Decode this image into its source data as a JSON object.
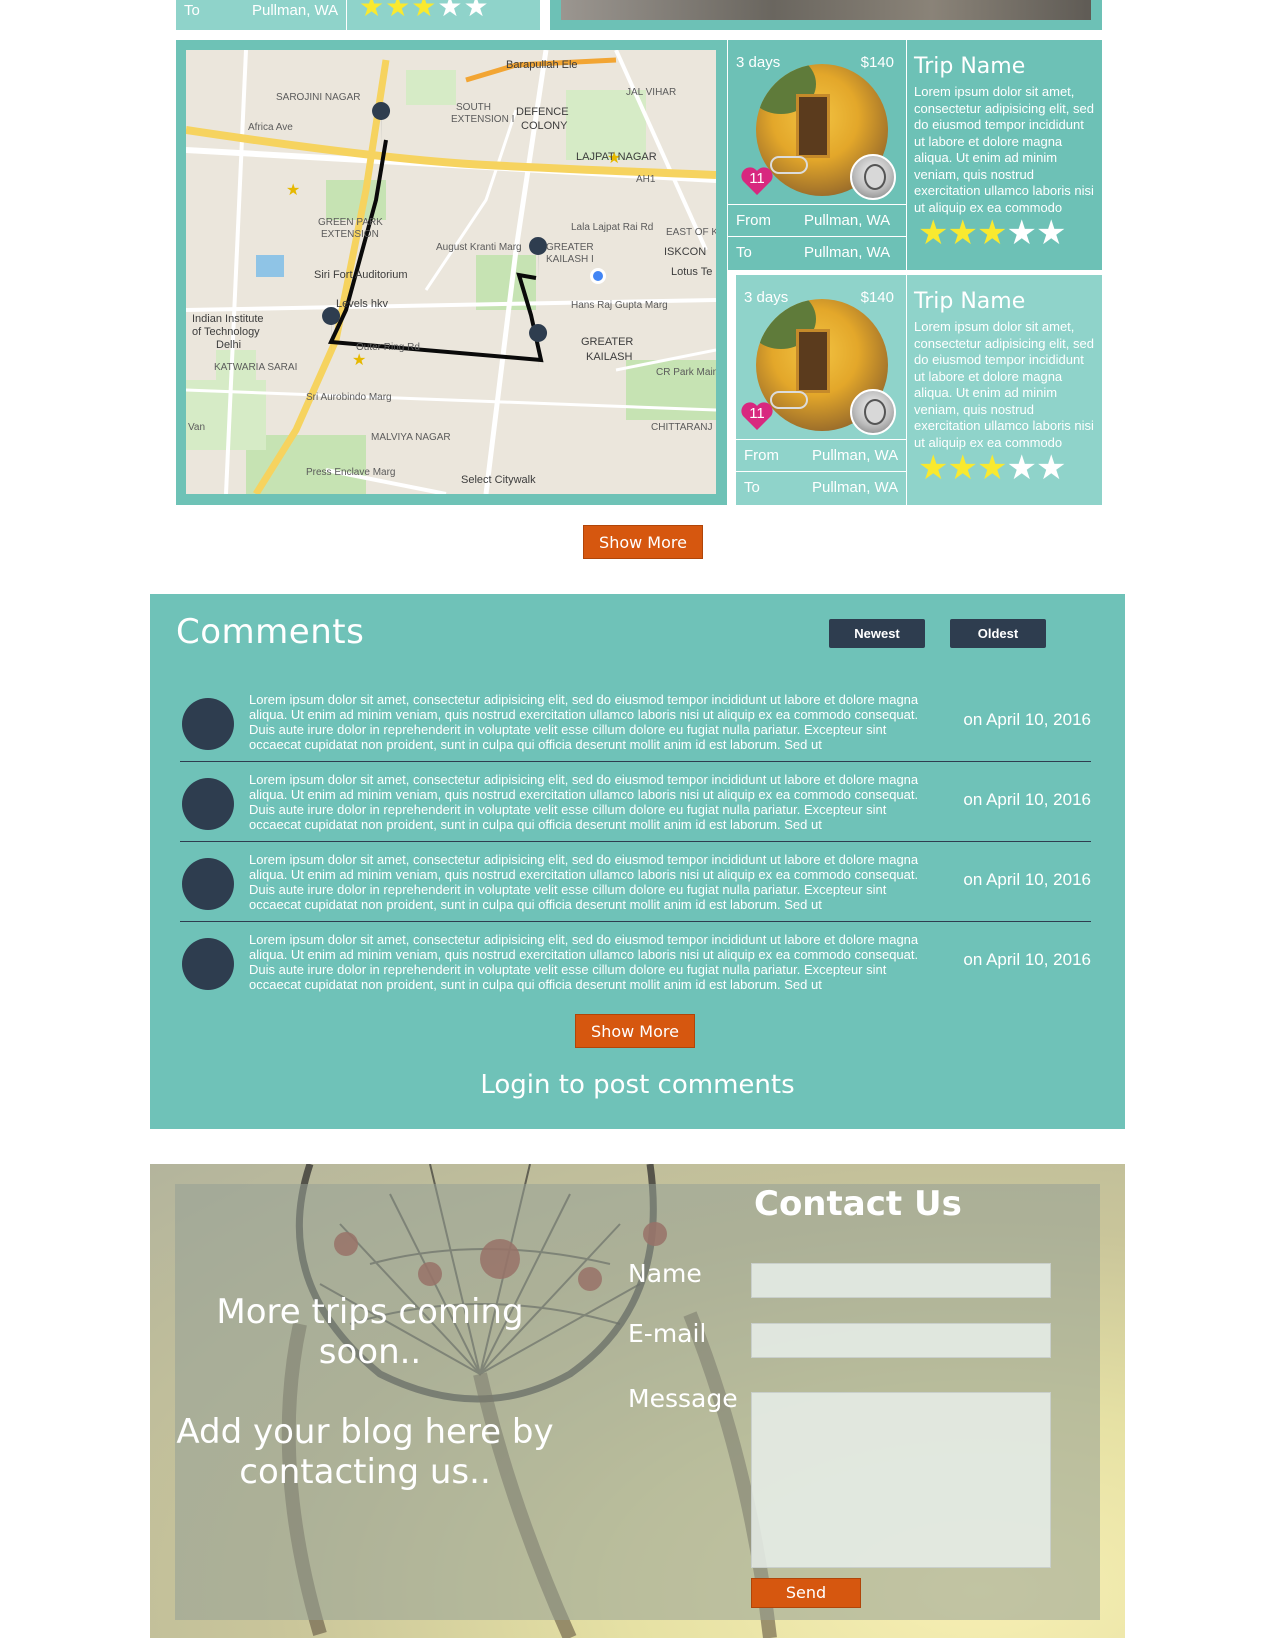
{
  "top_row": {
    "to_label": "To",
    "to_value": "Pullman, WA",
    "rating": 3
  },
  "map": {
    "labels": [
      "Barapullah Ele",
      "JAL VIHAR",
      "SAROJINI NAGAR",
      "SOUTH EXTENSION I",
      "DEFENCE COLONY",
      "LAJPAT NAGAR",
      "GREEN PARK EXTENSION",
      "August Kranti Marg",
      "Lala Lajpat Rai Rd",
      "GREATER KAILASH I",
      "EAST OF KA",
      "ISKCON",
      "Lotus Te",
      "Siri Fort Auditorium",
      "Levels hkv",
      "Indian Institute of Technology Delhi",
      "KATWARIA SARAI",
      "Outer Ring Rd",
      "Hans Raj Gupta Marg",
      "GREATER KAILASH",
      "CR Park Main",
      "Sri Aurobindo Marg",
      "MALVIYA NAGAR",
      "CHITTARANJ",
      "Press Enclave Marg",
      "Select Citywalk",
      "Africa Ave",
      "Van",
      "AH1"
    ],
    "attribution": "Select Citywalk"
  },
  "trips": [
    {
      "days": "3 days",
      "price": "$140",
      "likes": "11",
      "from_label": "From",
      "from_value": "Pullman, WA",
      "to_label": "To",
      "to_value": "Pullman, WA",
      "name": "Trip Name",
      "description": "Lorem ipsum dolor sit amet, consectetur adipisicing elit, sed do eiusmod tempor incididunt ut labore et dolore magna aliqua. Ut enim ad minim veniam, quis nostrud exercitation ullamco laboris nisi ut aliquip ex ea commodo",
      "rating": 3,
      "background": "#6dc1b6"
    },
    {
      "days": "3 days",
      "price": "$140",
      "likes": "11",
      "from_label": "From",
      "from_value": "Pullman, WA",
      "to_label": "To",
      "to_value": "Pullman, WA",
      "name": "Trip Name",
      "description": "Lorem ipsum dolor sit amet, consectetur adipisicing elit, sed do eiusmod tempor incididunt ut labore et dolore magna aliqua. Ut enim ad minim veniam, quis nostrud exercitation ullamco laboris nisi ut aliquip ex ea commodo",
      "rating": 3,
      "background": "#8fd3ca"
    }
  ],
  "trips_show_more": "Show More",
  "comments": {
    "title": "Comments",
    "sort_newest": "Newest",
    "sort_oldest": "Oldest",
    "items": [
      {
        "text": "Lorem ipsum dolor sit amet, consectetur adipisicing elit, sed do eiusmod tempor incididunt ut labore et dolore magna aliqua. Ut enim ad minim veniam, quis nostrud exercitation ullamco laboris nisi ut aliquip ex ea commodo consequat. Duis aute irure dolor in reprehenderit in voluptate velit esse cillum dolore eu fugiat nulla pariatur. Excepteur sint occaecat cupidatat non proident, sunt in culpa qui officia deserunt mollit anim id est laborum. Sed ut",
        "date": "on April 10, 2016"
      },
      {
        "text": "Lorem ipsum dolor sit amet, consectetur adipisicing elit, sed do eiusmod tempor incididunt ut labore et dolore magna aliqua. Ut enim ad minim veniam, quis nostrud exercitation ullamco laboris nisi ut aliquip ex ea commodo consequat. Duis aute irure dolor in reprehenderit in voluptate velit esse cillum dolore eu fugiat nulla pariatur. Excepteur sint occaecat cupidatat non proident, sunt in culpa qui officia deserunt mollit anim id est laborum. Sed ut",
        "date": "on April 10, 2016"
      },
      {
        "text": "Lorem ipsum dolor sit amet, consectetur adipisicing elit, sed do eiusmod tempor incididunt ut labore et dolore magna aliqua. Ut enim ad minim veniam, quis nostrud exercitation ullamco laboris nisi ut aliquip ex ea commodo consequat. Duis aute irure dolor in reprehenderit in voluptate velit esse cillum dolore eu fugiat nulla pariatur. Excepteur sint occaecat cupidatat non proident, sunt in culpa qui officia deserunt mollit anim id est laborum. Sed ut",
        "date": "on April 10, 2016"
      },
      {
        "text": "Lorem ipsum dolor sit amet, consectetur adipisicing elit, sed do eiusmod tempor incididunt ut labore et dolore magna aliqua. Ut enim ad minim veniam, quis nostrud exercitation ullamco laboris nisi ut aliquip ex ea commodo consequat. Duis aute irure dolor in reprehenderit in voluptate velit esse cillum dolore eu fugiat nulla pariatur. Excepteur sint occaecat cupidatat non proident, sunt in culpa qui officia deserunt mollit anim id est laborum. Sed ut",
        "date": "on April 10, 2016"
      }
    ],
    "show_more": "Show More",
    "login_prompt": "Login to post comments"
  },
  "contact": {
    "more_trips": "More trips coming soon..",
    "add_blog": "Add your blog here by contacting us..",
    "title": "Contact Us",
    "name_label": "Name",
    "email_label": "E-mail",
    "message_label": "Message",
    "name_value": "",
    "email_value": "",
    "message_value": "",
    "send_label": "Send"
  },
  "colors": {
    "teal": "#6fc2b8",
    "teal_light": "#8fd3ca",
    "navy": "#2e3d4f",
    "orange": "#d6570f",
    "star": "#f9e92f",
    "heart": "#d8287f"
  }
}
